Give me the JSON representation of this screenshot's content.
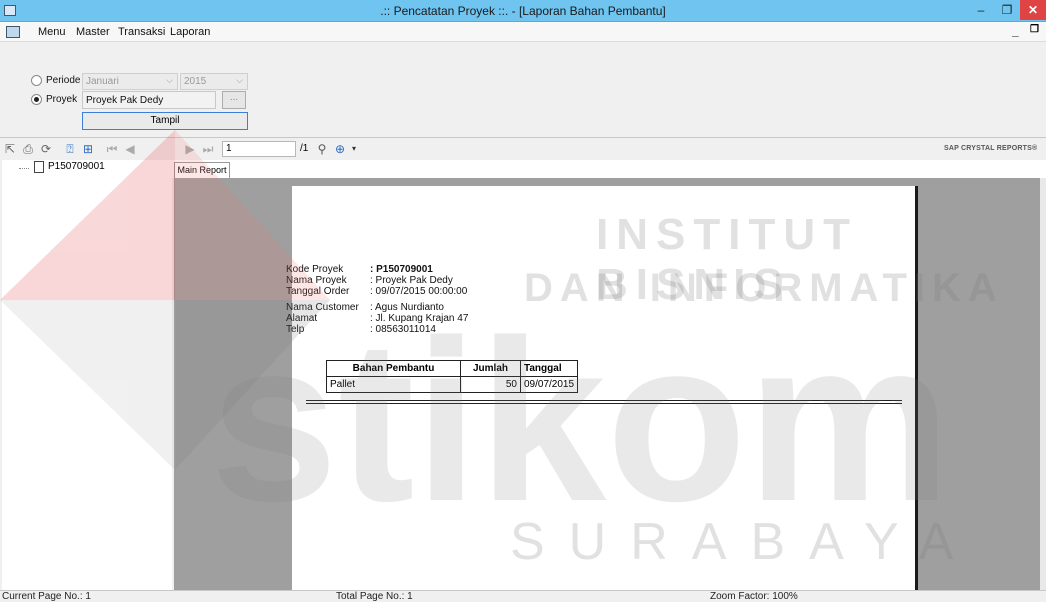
{
  "window": {
    "title": ".:: Pencatatan Proyek ::. - [Laporan Bahan Pembantu]",
    "minimize": "–",
    "restore": "❐",
    "close": "✕"
  },
  "menu": {
    "items": [
      "Menu",
      "Master",
      "Transaksi",
      "Laporan"
    ],
    "mdi_min": "_",
    "mdi_restore": "❐"
  },
  "filter": {
    "periode_label": "Periode",
    "periode_checked": false,
    "bulan_value": "Januari",
    "tahun_value": "2015",
    "proyek_label": "Proyek",
    "proyek_checked": true,
    "proyek_value": "Proyek Pak Dedy",
    "browse_label": "...",
    "tampil_label": "Tampil"
  },
  "toolbar": {
    "page_input": "1",
    "page_total": "/1",
    "brand": "SAP CRYSTAL REPORTS®"
  },
  "tree": {
    "node": "P150709001"
  },
  "tabs": {
    "main": "Main Report"
  },
  "report": {
    "kode_label": "Kode Proyek",
    "kode_value": ": P150709001",
    "nama_label": "Nama Proyek",
    "nama_value": ": Proyek Pak Dedy",
    "tanggal_label": "Tanggal Order",
    "tanggal_value": ": 09/07/2015  00:00:00",
    "customer_label": "Nama Customer",
    "customer_value": ": Agus Nurdianto",
    "alamat_label": "Alamat",
    "alamat_value": ": Jl. Kupang Krajan 47",
    "telp_label": "Telp",
    "telp_value": ": 08563011014",
    "table": {
      "headers": [
        "Bahan Pembantu",
        "Jumlah",
        "Tanggal"
      ],
      "rows": [
        [
          "Pallet",
          "50",
          "09/07/2015"
        ]
      ]
    }
  },
  "watermark": {
    "line1": "INSTITUT BISNIS",
    "line2": "DAN INFORMATIKA",
    "line3": "SURABAYA",
    "brand_word": "stikom"
  },
  "status": {
    "current_page": "Current Page No.: 1",
    "total_page": "Total Page No.: 1",
    "zoom": "Zoom Factor: 100%"
  },
  "colors": {
    "titlebar": "#6fc4f0",
    "close": "#e04343",
    "logo_red": "#e0252b",
    "logo_gray": "#7b7b7b"
  }
}
